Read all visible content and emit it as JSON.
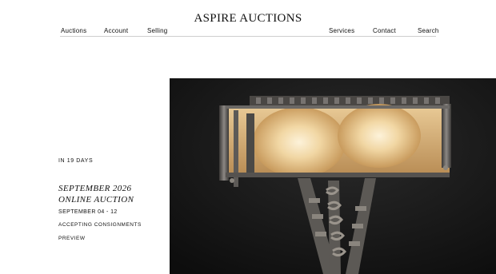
{
  "brand": "ASPIRE AUCTIONS",
  "nav": {
    "auctions": "Auctions",
    "account": "Account",
    "selling": "Selling",
    "services": "Services",
    "contact": "Contact",
    "search": "Search"
  },
  "hero": {
    "image": "art-deco-table-lamp-photo"
  },
  "auction": {
    "countdown": "IN 19 DAYS",
    "title_line1": "SEPTEMBER 2026",
    "title_line2": "ONLINE AUCTION",
    "dates": "SEPTEMBER 04 - 12",
    "consign_link": "ACCEPTING CONSIGNMENTS",
    "preview_link": "PREVIEW"
  }
}
